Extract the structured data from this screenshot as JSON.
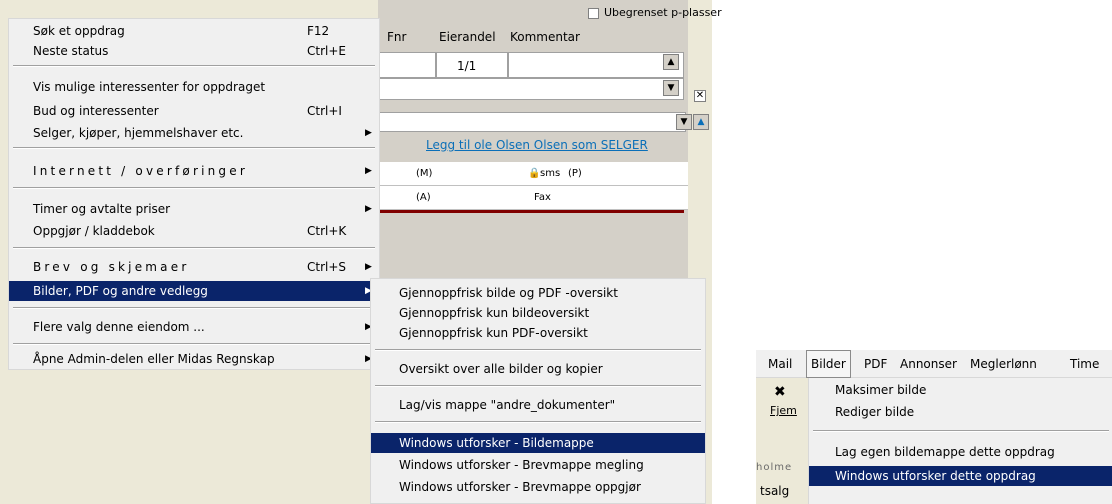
{
  "background": {
    "checkbox_label": "Ubegrenset p-plasser",
    "columns": [
      "Fnr",
      "Eierandel",
      "Kommentar"
    ],
    "row1_eierandel": "1/1",
    "link_text": "Legg til ole Olsen Olsen som SELGER",
    "label_m": "(M)",
    "label_sms": "sms",
    "label_p": "(P)",
    "label_a": "(A)",
    "label_fax": "Fax"
  },
  "main_menu": {
    "items": [
      {
        "label": "Søk et oppdrag",
        "shortcut": "F12"
      },
      {
        "label": "Neste status",
        "shortcut": "Ctrl+E"
      },
      {
        "label": "Vis mulige interessenter for oppdraget",
        "shortcut": ""
      },
      {
        "label": "Bud og interessenter",
        "shortcut": "Ctrl+I"
      },
      {
        "label": "Selger, kjøper, hjemmelshaver etc.",
        "shortcut": ""
      },
      {
        "label": "Internett / overføringer",
        "shortcut": ""
      },
      {
        "label": "Timer og avtalte priser",
        "shortcut": ""
      },
      {
        "label": "Oppgjør / kladdebok",
        "shortcut": "Ctrl+K"
      },
      {
        "label": "Brev og skjemaer",
        "shortcut": "Ctrl+S"
      },
      {
        "label": "Bilder, PDF og andre vedlegg",
        "shortcut": ""
      },
      {
        "label": "Flere valg denne eiendom ...",
        "shortcut": ""
      },
      {
        "label": "Åpne Admin-delen eller Midas Regnskap",
        "shortcut": ""
      }
    ]
  },
  "sub_menu": {
    "items": [
      "Gjennoppfrisk bilde og PDF -oversikt",
      "Gjennoppfrisk kun bildeoversikt",
      "Gjennoppfrisk kun PDF-oversikt",
      "Oversikt over alle bilder og kopier",
      "Lag/vis mappe \"andre_dokumenter\"",
      "Windows utforsker - Bildemappe",
      "Windows utforsker - Brevmappe megling",
      "Windows utforsker - Brevmappe oppgjør"
    ]
  },
  "snippet": {
    "menubar": [
      "Mail",
      "Bilder",
      "PDF",
      "Annonser",
      "Meglerlønn",
      "Time"
    ],
    "fjem_label": "Fjem",
    "holme_text": "holme",
    "tsalg_text": "tsalg",
    "bilder_menu": [
      "Maksimer bilde",
      "Rediger bilde",
      "Lag egen bildemappe dette oppdrag",
      "Windows utforsker dette oppdrag"
    ]
  }
}
